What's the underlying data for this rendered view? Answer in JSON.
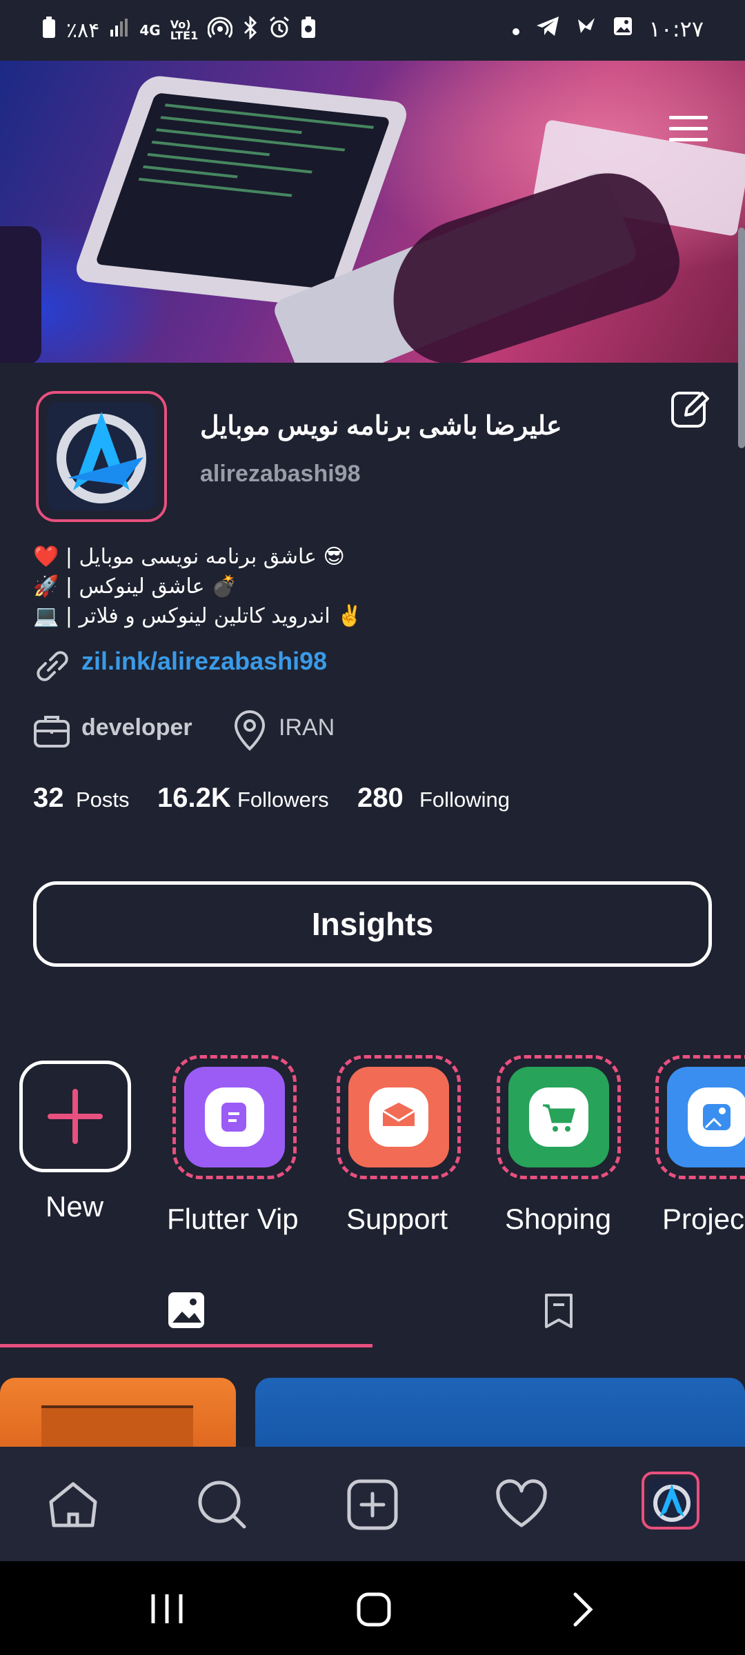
{
  "status_bar": {
    "time": "۱۰:۲۷",
    "battery": "٪۸۴",
    "network": "4G",
    "volte": "Vo) LTE1"
  },
  "profile": {
    "full_name": "علیرضا باشی برنامه نویس موبایل",
    "username": "alirezabashi98",
    "bio": [
      "❤️ | عاشق برنامه نویسی موبایل 😎",
      "🚀 | عاشق لینوکس 💣",
      "💻 | اندروید کاتلین لینوکس و فلاتر ✌️"
    ],
    "link": "zil.ink/alirezabashi98",
    "job": "developer",
    "location": "IRAN",
    "stats": {
      "posts_count": "32",
      "posts_label": "Posts",
      "followers_count": "16.2K",
      "followers_label": "Followers",
      "following_count": "280",
      "following_label": "Following"
    },
    "insights_label": "Insights"
  },
  "highlights": [
    {
      "label": "New",
      "icon": "plus-icon"
    },
    {
      "label": "Flutter Vip",
      "icon": "notes-icon",
      "color": "#9b5cf6"
    },
    {
      "label": "Support",
      "icon": "mail-icon",
      "color": "#f26b55"
    },
    {
      "label": "Shoping",
      "icon": "cart-icon",
      "color": "#27a35a"
    },
    {
      "label": "Projec",
      "icon": "photo-icon",
      "color": "#3a8ef0"
    }
  ],
  "tabs": [
    {
      "name": "posts",
      "icon": "image-icon",
      "active": true
    },
    {
      "name": "saved",
      "icon": "bookmark-icon",
      "active": false
    }
  ],
  "bottom_nav": [
    "home-icon",
    "search-icon",
    "add-icon",
    "heart-icon",
    "profile-avatar"
  ],
  "colors": {
    "background": "#1f2230",
    "accent": "#e8507f",
    "link": "#3a9be8",
    "muted": "#9a9ca8"
  }
}
